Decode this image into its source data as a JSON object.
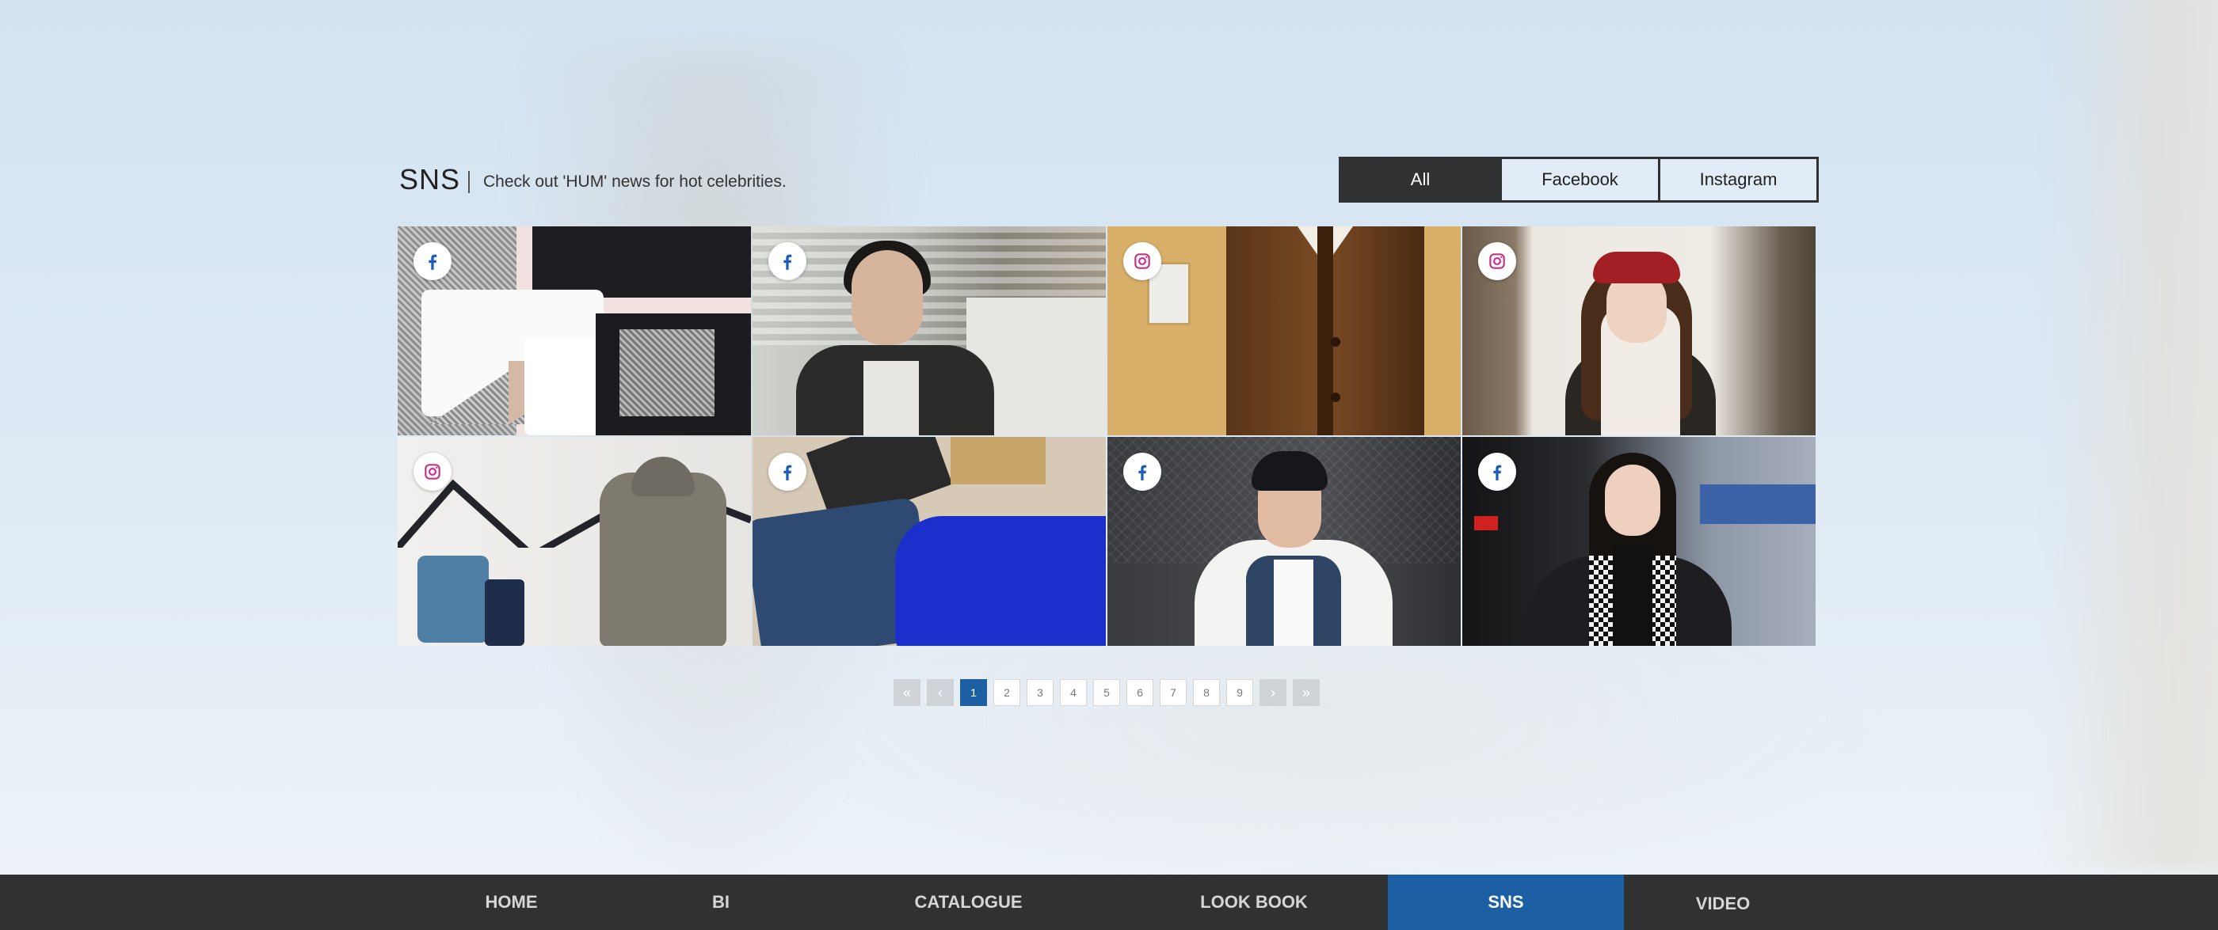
{
  "section": {
    "title": "SNS",
    "subtitle": "Check out 'HUM' news for hot celebrities."
  },
  "filters": [
    {
      "label": "All",
      "active": true
    },
    {
      "label": "Facebook",
      "active": false
    },
    {
      "label": "Instagram",
      "active": false
    }
  ],
  "posts": [
    {
      "source": "facebook",
      "icon": "facebook-icon",
      "subject": "folded t-shirts"
    },
    {
      "source": "facebook",
      "icon": "facebook-icon",
      "subject": "man indoors"
    },
    {
      "source": "instagram",
      "icon": "instagram-icon",
      "subject": "brown coat"
    },
    {
      "source": "instagram",
      "icon": "instagram-icon",
      "subject": "woman in red beret"
    },
    {
      "source": "instagram",
      "icon": "instagram-icon",
      "subject": "jeans and parka"
    },
    {
      "source": "facebook",
      "icon": "facebook-icon",
      "subject": "jeans and blue sweater flatlay"
    },
    {
      "source": "facebook",
      "icon": "facebook-icon",
      "subject": "man in white jacket"
    },
    {
      "source": "facebook",
      "icon": "facebook-icon",
      "subject": "woman in black coat"
    }
  ],
  "pagination": {
    "first": "«",
    "prev": "‹",
    "pages": [
      "1",
      "2",
      "3",
      "4",
      "5",
      "6",
      "7",
      "8",
      "9"
    ],
    "current": "1",
    "next": "›",
    "last": "»"
  },
  "nav": {
    "items": [
      {
        "label": "HOME",
        "active": false
      },
      {
        "label": "BI",
        "active": false
      },
      {
        "label": "CATALOGUE",
        "active": false
      },
      {
        "label": "LOOK BOOK",
        "active": false
      },
      {
        "label": "SNS",
        "active": true
      },
      {
        "label": "VIDEO",
        "active": false
      }
    ]
  },
  "colors": {
    "accent": "#1d5fa3",
    "dark": "#2f3133",
    "facebook": "#1f5fba",
    "instagram": "#c13584"
  }
}
